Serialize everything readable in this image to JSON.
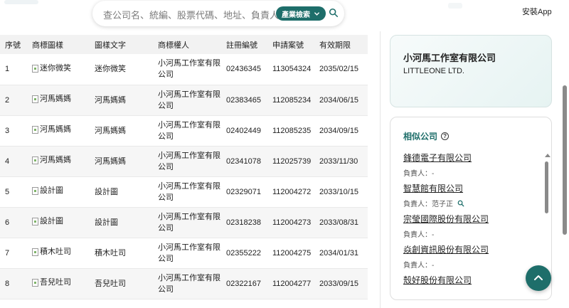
{
  "header": {
    "search_placeholder": "查公司名、統編、股票代碼、地址、負責人",
    "filter_label": "產業檢索",
    "install_app": "安裝App"
  },
  "table": {
    "columns": [
      "序號",
      "商標圖樣",
      "圖樣文字",
      "商標權人",
      "註冊編號",
      "申請案號",
      "有效期限"
    ],
    "rows": [
      {
        "no": "1",
        "logo_alt": "迷你微笑",
        "text": "迷你微笑",
        "owner": "小河馬工作室有限公司",
        "reg_no": "02436345",
        "app_no": "113054324",
        "expiry": "2035/02/15"
      },
      {
        "no": "2",
        "logo_alt": "河馬媽媽",
        "text": "河馬媽媽",
        "owner": "小河馬工作室有限公司",
        "reg_no": "02383465",
        "app_no": "112085234",
        "expiry": "2034/06/15"
      },
      {
        "no": "3",
        "logo_alt": "河馬媽媽",
        "text": "河馬媽媽",
        "owner": "小河馬工作室有限公司",
        "reg_no": "02402449",
        "app_no": "112085235",
        "expiry": "2034/09/15"
      },
      {
        "no": "4",
        "logo_alt": "河馬媽媽",
        "text": "河馬媽媽",
        "owner": "小河馬工作室有限公司",
        "reg_no": "02341078",
        "app_no": "112025739",
        "expiry": "2033/11/30"
      },
      {
        "no": "5",
        "logo_alt": "設計圖",
        "text": "設計圖",
        "owner": "小河馬工作室有限公司",
        "reg_no": "02329071",
        "app_no": "112004272",
        "expiry": "2033/10/15"
      },
      {
        "no": "6",
        "logo_alt": "設計圖",
        "text": "設計圖",
        "owner": "小河馬工作室有限公司",
        "reg_no": "02318238",
        "app_no": "112004273",
        "expiry": "2033/08/31"
      },
      {
        "no": "7",
        "logo_alt": "積木吐司",
        "text": "積木吐司",
        "owner": "小河馬工作室有限公司",
        "reg_no": "02355222",
        "app_no": "112004275",
        "expiry": "2034/01/31"
      },
      {
        "no": "8",
        "logo_alt": "吾兒吐司",
        "text": "吾兒吐司",
        "owner": "小河馬工作室有限公司",
        "reg_no": "02322167",
        "app_no": "112004277",
        "expiry": "2033/09/15"
      }
    ]
  },
  "company": {
    "name": "小河馬工作室有限公司",
    "name_en": "LITTLEONE LTD."
  },
  "similar": {
    "title": "相似公司",
    "items": [
      {
        "name": "鋒德電子有限公司",
        "person": "負責人：-",
        "searchable": false
      },
      {
        "name": "智慧館有限公司",
        "person": "負責人：范子正",
        "searchable": true
      },
      {
        "name": "宗瑩國際股份有限公司",
        "person": "負責人：-",
        "searchable": false
      },
      {
        "name": "焱創資訊股份有限公司",
        "person": "負責人：-",
        "searchable": false
      },
      {
        "name": "殼好股份有限公司",
        "person": "",
        "searchable": false
      }
    ]
  },
  "colors": {
    "accent": "#1e6e6a"
  }
}
